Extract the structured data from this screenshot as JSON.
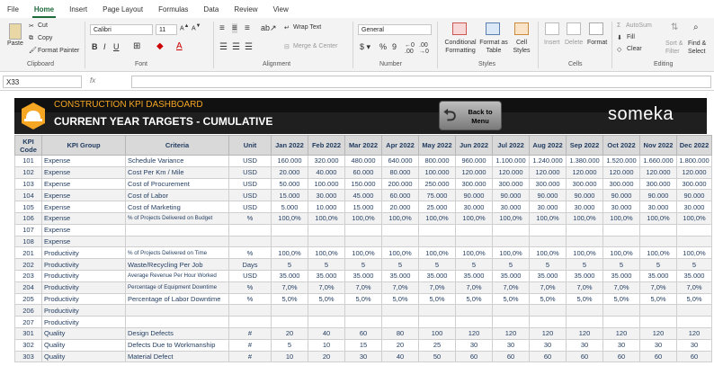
{
  "menu": {
    "tabs": [
      "File",
      "Home",
      "Insert",
      "Page Layout",
      "Formulas",
      "Data",
      "Review",
      "View"
    ],
    "active": "Home"
  },
  "ribbon": {
    "clipboard": {
      "paste": "Paste",
      "cut": "Cut",
      "copy": "Copy",
      "format_painter": "Format Painter",
      "label": "Clipboard"
    },
    "font": {
      "name": "Calibri",
      "size": "11",
      "label": "Font"
    },
    "alignment": {
      "wrap_text": "Wrap Text",
      "merge_center": "Merge & Center",
      "label": "Alignment"
    },
    "number": {
      "format": "General",
      "label": "Number"
    },
    "styles": {
      "conditional": "Conditional Formatting",
      "format_as_table": "Format as Table",
      "cell_styles": "Cell Styles",
      "label": "Styles"
    },
    "cells": {
      "insert": "Insert",
      "delete": "Delete",
      "format": "Format",
      "label": "Cells"
    },
    "editing": {
      "autosum": "AutoSum",
      "fill": "Fill",
      "clear": "Clear",
      "sort_filter": "Sort & Filter",
      "find_select": "Find & Select",
      "label": "Editing"
    }
  },
  "formula_bar": {
    "name_box": "X33",
    "fx": "fx",
    "content": ""
  },
  "banner": {
    "title": "CONSTRUCTION KPI DASHBOARD",
    "subtitle": "CURRENT YEAR TARGETS - CUMULATIVE",
    "back_button": "Back to Menu",
    "brand": "someka"
  },
  "table": {
    "headers": [
      "KPI Code",
      "KPI Group",
      "Criteria",
      "Unit",
      "Jan 2022",
      "Feb 2022",
      "Mar 2022",
      "Apr 2022",
      "May 2022",
      "Jun 2022",
      "Jul 2022",
      "Aug 2022",
      "Sep 2022",
      "Oct 2022",
      "Nov 2022",
      "Dec 2022"
    ],
    "rows": [
      {
        "code": "101",
        "group": "Expense",
        "criteria": "Schedule Variance",
        "unit": "USD",
        "values": [
          "160.000",
          "320.000",
          "480.000",
          "640.000",
          "800.000",
          "960.000",
          "1.100.000",
          "1.240.000",
          "1.380.000",
          "1.520.000",
          "1.660.000",
          "1.800.000"
        ]
      },
      {
        "code": "102",
        "group": "Expense",
        "criteria": "Cost Per Km / Mile",
        "unit": "USD",
        "values": [
          "20.000",
          "40.000",
          "60.000",
          "80.000",
          "100.000",
          "120.000",
          "120.000",
          "120.000",
          "120.000",
          "120.000",
          "120.000",
          "120.000"
        ]
      },
      {
        "code": "103",
        "group": "Expense",
        "criteria": "Cost of Procurement",
        "unit": "USD",
        "values": [
          "50.000",
          "100.000",
          "150.000",
          "200.000",
          "250.000",
          "300.000",
          "300.000",
          "300.000",
          "300.000",
          "300.000",
          "300.000",
          "300.000"
        ]
      },
      {
        "code": "104",
        "group": "Expense",
        "criteria": "Cost of Labor",
        "unit": "USD",
        "values": [
          "15.000",
          "30.000",
          "45.000",
          "60.000",
          "75.000",
          "90.000",
          "90.000",
          "90.000",
          "90.000",
          "90.000",
          "90.000",
          "90.000"
        ]
      },
      {
        "code": "105",
        "group": "Expense",
        "criteria": "Cost of Marketing",
        "unit": "USD",
        "values": [
          "5.000",
          "10.000",
          "15.000",
          "20.000",
          "25.000",
          "30.000",
          "30.000",
          "30.000",
          "30.000",
          "30.000",
          "30.000",
          "30.000"
        ]
      },
      {
        "code": "106",
        "group": "Expense",
        "criteria": "% of Projects Delivered on Budget",
        "unit": "%",
        "small": true,
        "values": [
          "100,0%",
          "100,0%",
          "100,0%",
          "100,0%",
          "100,0%",
          "100,0%",
          "100,0%",
          "100,0%",
          "100,0%",
          "100,0%",
          "100,0%",
          "100,0%"
        ]
      },
      {
        "code": "107",
        "group": "Expense",
        "criteria": "",
        "unit": "",
        "values": [
          "",
          "",
          "",
          "",
          "",
          "",
          "",
          "",
          "",
          "",
          "",
          ""
        ]
      },
      {
        "code": "108",
        "group": "Expense",
        "criteria": "",
        "unit": "",
        "values": [
          "",
          "",
          "",
          "",
          "",
          "",
          "",
          "",
          "",
          "",
          "",
          ""
        ]
      },
      {
        "code": "201",
        "group": "Productivity",
        "criteria": "% of Projects Delivered on Time",
        "unit": "%",
        "small": true,
        "values": [
          "100,0%",
          "100,0%",
          "100,0%",
          "100,0%",
          "100,0%",
          "100,0%",
          "100,0%",
          "100,0%",
          "100,0%",
          "100,0%",
          "100,0%",
          "100,0%"
        ]
      },
      {
        "code": "202",
        "group": "Productivity",
        "criteria": "Waste/Recycling Per Job",
        "unit": "Days",
        "values": [
          "5",
          "5",
          "5",
          "5",
          "5",
          "5",
          "5",
          "5",
          "5",
          "5",
          "5",
          "5"
        ]
      },
      {
        "code": "203",
        "group": "Productivity",
        "criteria": "Average Revenue Per Hour Worked",
        "unit": "USD",
        "small": true,
        "values": [
          "35.000",
          "35.000",
          "35.000",
          "35.000",
          "35.000",
          "35.000",
          "35.000",
          "35.000",
          "35.000",
          "35.000",
          "35.000",
          "35.000"
        ]
      },
      {
        "code": "204",
        "group": "Productivity",
        "criteria": "Percentage of Equipment Downtime",
        "unit": "%",
        "small": true,
        "values": [
          "7,0%",
          "7,0%",
          "7,0%",
          "7,0%",
          "7,0%",
          "7,0%",
          "7,0%",
          "7,0%",
          "7,0%",
          "7,0%",
          "7,0%",
          "7,0%"
        ]
      },
      {
        "code": "205",
        "group": "Productivity",
        "criteria": "Percentage of Labor Downtime",
        "unit": "%",
        "values": [
          "5,0%",
          "5,0%",
          "5,0%",
          "5,0%",
          "5,0%",
          "5,0%",
          "5,0%",
          "5,0%",
          "5,0%",
          "5,0%",
          "5,0%",
          "5,0%"
        ]
      },
      {
        "code": "206",
        "group": "Productivity",
        "criteria": "",
        "unit": "",
        "values": [
          "",
          "",
          "",
          "",
          "",
          "",
          "",
          "",
          "",
          "",
          "",
          ""
        ]
      },
      {
        "code": "207",
        "group": "Productivity",
        "criteria": "",
        "unit": "",
        "values": [
          "",
          "",
          "",
          "",
          "",
          "",
          "",
          "",
          "",
          "",
          "",
          ""
        ]
      },
      {
        "code": "301",
        "group": "Quality",
        "criteria": "Design Defects",
        "unit": "#",
        "values": [
          "20",
          "40",
          "60",
          "80",
          "100",
          "120",
          "120",
          "120",
          "120",
          "120",
          "120",
          "120"
        ]
      },
      {
        "code": "302",
        "group": "Quality",
        "criteria": "Defects Due to Workmanship",
        "unit": "#",
        "values": [
          "5",
          "10",
          "15",
          "20",
          "25",
          "30",
          "30",
          "30",
          "30",
          "30",
          "30",
          "30"
        ]
      },
      {
        "code": "303",
        "group": "Quality",
        "criteria": "Material Defect",
        "unit": "#",
        "values": [
          "10",
          "20",
          "30",
          "40",
          "50",
          "60",
          "60",
          "60",
          "60",
          "60",
          "60",
          "60"
        ]
      }
    ]
  }
}
